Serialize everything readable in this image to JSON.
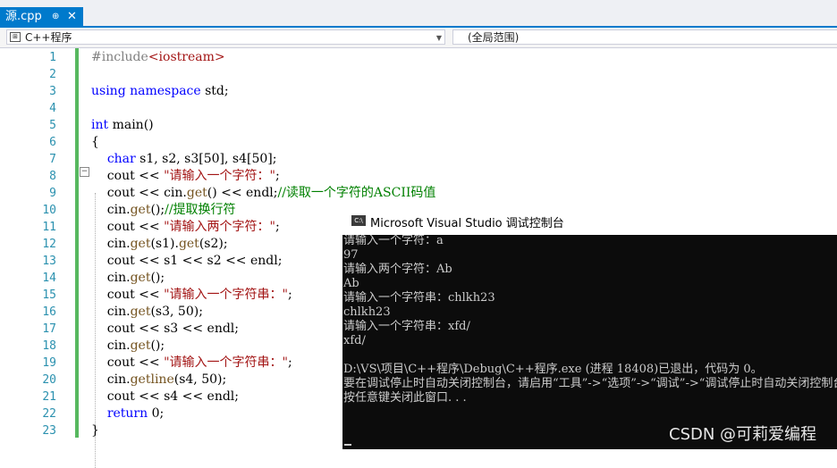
{
  "tab": {
    "label": "源.cpp",
    "pin_glyph": "⊕",
    "close_glyph": "✕"
  },
  "nav": {
    "project": "C++程序",
    "scope": "(全局范围)"
  },
  "editor": {
    "line_numbers": [
      "1",
      "2",
      "3",
      "4",
      "5",
      "6",
      "7",
      "8",
      "9",
      "10",
      "11",
      "12",
      "13",
      "14",
      "15",
      "16",
      "17",
      "18",
      "19",
      "20",
      "21",
      "22",
      "23"
    ],
    "lines": [
      "#include<iostream>",
      "",
      "using namespace std;",
      "",
      "int main()",
      "{",
      "    char s1, s2, s3[50], s4[50];",
      "    cout << \"请输入一个字符：\";",
      "    cout << cin.get() << endl;//读取一个字符的ASCII码值",
      "    cin.get();//提取换行符",
      "    cout << \"请输入两个字符：\";",
      "    cin.get(s1).get(s2);",
      "    cout << s1 << s2 << endl;",
      "    cin.get();",
      "    cout << \"请输入一个字符串：\";",
      "    cin.get(s3, 50);",
      "    cout << s3 << endl;",
      "    cin.get();",
      "    cout << \"请输入一个字符串：\";",
      "    cin.getline(s4, 50);",
      "    cout << s4 << endl;",
      "    return 0;",
      "}"
    ]
  },
  "console": {
    "title": "Microsoft Visual Studio 调试控制台",
    "icon_text": "C:\\",
    "lines": [
      "请输入一个字符：a",
      "97",
      "请输入两个字符：Ab",
      "Ab",
      "请输入一个字符串：chlkh23",
      "chlkh23",
      "请输入一个字符串：xfd/",
      "xfd/",
      "",
      "D:\\VS\\项目\\C++程序\\Debug\\C++程序.exe (进程 18408)已退出，代码为 0。",
      "要在调试停止时自动关闭控制台，请启用“工具”->“选项”->“调试”->“调试停止时自动关闭控制台”。",
      "按任意键关闭此窗口. . ."
    ]
  },
  "watermark": "CSDN @可莉爱编程",
  "colors": {
    "accent": "#007acc",
    "keyword": "#0000ff",
    "string": "#a31515",
    "comment": "#008000",
    "console_bg": "#0c0c0c"
  }
}
